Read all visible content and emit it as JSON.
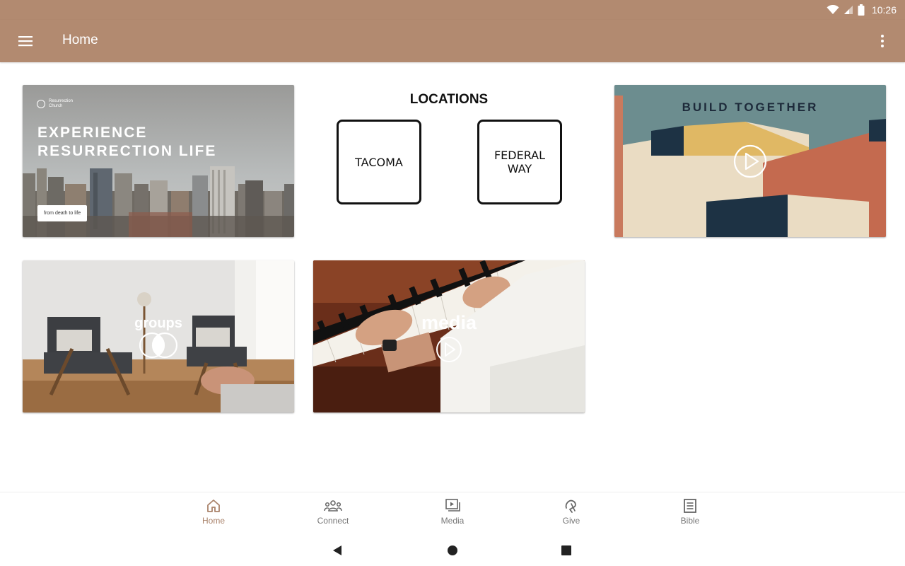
{
  "status_bar": {
    "time": "10:26"
  },
  "app_bar": {
    "title": "Home"
  },
  "cards": {
    "experience": {
      "logo_text": "Resurrection Church",
      "headline_line1": "EXPERIENCE",
      "headline_line2": "RESURRECTION LIFE",
      "pill": "from death to life"
    },
    "locations": {
      "title": "LOCATIONS",
      "tacoma": "TACOMA",
      "federal_line1": "FEDERAL",
      "federal_line2": "WAY"
    },
    "build": {
      "title": "BUILD TOGETHER"
    },
    "groups": {
      "label": "groups"
    },
    "media": {
      "label": "media"
    }
  },
  "bottom_nav": {
    "items": [
      {
        "label": "Home",
        "icon": "home-icon",
        "active": true
      },
      {
        "label": "Connect",
        "icon": "people-icon"
      },
      {
        "label": "Media",
        "icon": "video-library-icon"
      },
      {
        "label": "Give",
        "icon": "give-icon"
      },
      {
        "label": "Bible",
        "icon": "book-icon"
      }
    ]
  },
  "colors": {
    "primary": "#b28a70",
    "active_nav": "#a9826a",
    "inactive_nav": "#777777"
  }
}
